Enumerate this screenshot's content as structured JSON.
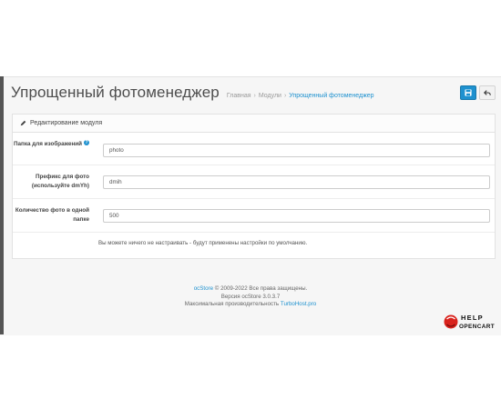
{
  "header": {
    "title": "Упрощенный фотоменеджер",
    "breadcrumb": [
      {
        "label": "Главная"
      },
      {
        "label": "Модули"
      },
      {
        "label": "Упрощенный фотоменеджер"
      }
    ],
    "save_icon": "save-icon",
    "back_icon": "back-arrow-icon"
  },
  "panel": {
    "heading": "Редактирование модуля",
    "heading_icon": "pencil-icon"
  },
  "form": {
    "folder_label": "Папка для изображений",
    "folder_value": "photo",
    "prefix_label": "Префикс для фото (используйте dmYh)",
    "prefix_value": "dmih",
    "count_label": "Количество фото в одной папке",
    "count_value": "500",
    "note": "Вы можете ничего не настраивать - будут применены настройки по умолчанию."
  },
  "footer": {
    "brand": "ocStore",
    "copyright": "© 2009-2022 Все права защищены.",
    "version": "Версия ocStore 3.0.3.7",
    "perf_text": "Максимальная производительность",
    "perf_link": "TurboHost.pro"
  },
  "logo": {
    "line1": "HELP",
    "line2": "OPENCART"
  },
  "colors": {
    "accent": "#1e91cf",
    "logo_red": "#d9221c"
  }
}
